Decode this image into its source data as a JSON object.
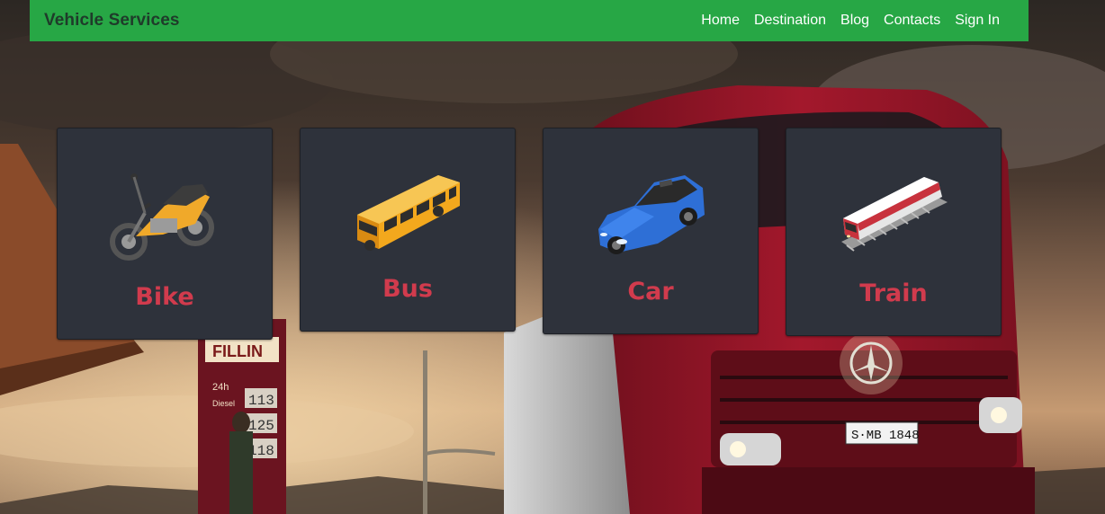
{
  "navbar": {
    "brand": "Vehicle Services",
    "links": [
      "Home",
      "Destination",
      "Blog",
      "Contacts",
      "Sign In"
    ]
  },
  "cards": [
    {
      "label": "Bike",
      "icon": "motorcycle-icon"
    },
    {
      "label": "Bus",
      "icon": "bus-icon"
    },
    {
      "label": "Car",
      "icon": "car-icon"
    },
    {
      "label": "Train",
      "icon": "train-icon"
    }
  ],
  "background": {
    "sign_brand": "FILLIN",
    "sign_hours": "24h",
    "sign_fuel": "Diesel",
    "sign_prices": [
      "113",
      "125",
      "118"
    ],
    "plate": "S·MB 1848"
  },
  "colors": {
    "navbar": "#27a745",
    "card": "#2e323b",
    "card_label": "#d13b4d",
    "truck": "#a3182c"
  }
}
